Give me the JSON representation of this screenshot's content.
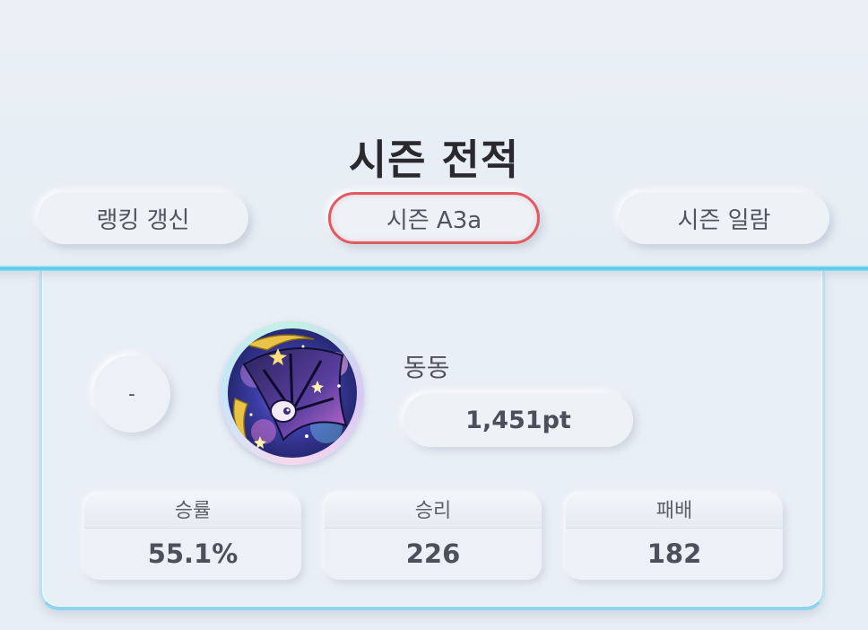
{
  "header": {
    "title": "시즌 전적",
    "buttons": {
      "ranking_refresh": "랭킹 갱신",
      "season_current": "시즌 A3a",
      "season_list": "시즌 일람"
    },
    "accent_color": "#e15a62",
    "divider_color": "#46c6e6"
  },
  "profile": {
    "rank": "-",
    "name": "동동",
    "points": "1,451pt",
    "avatar_icon": "lunala-avatar-icon"
  },
  "stats": [
    {
      "label": "승률",
      "value": "55.1%"
    },
    {
      "label": "승리",
      "value": "226"
    },
    {
      "label": "패배",
      "value": "182"
    }
  ]
}
